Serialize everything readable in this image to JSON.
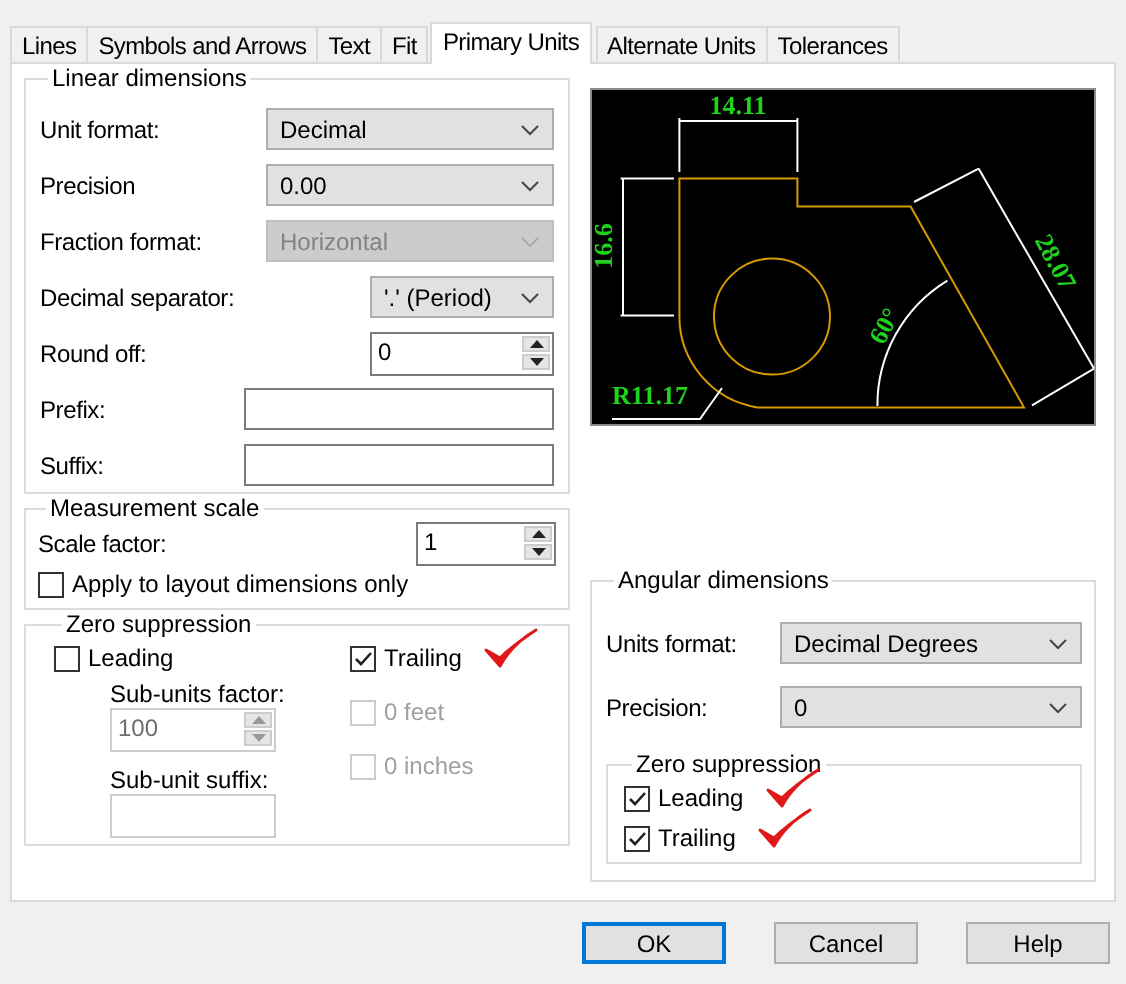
{
  "tabs": [
    {
      "label": "Lines",
      "selected": false
    },
    {
      "label": "Symbols and Arrows",
      "selected": false
    },
    {
      "label": "Text",
      "selected": false
    },
    {
      "label": "Fit",
      "selected": false
    },
    {
      "label": "Primary Units",
      "selected": true
    },
    {
      "label": "Alternate Units",
      "selected": false
    },
    {
      "label": "Tolerances",
      "selected": false
    }
  ],
  "linear_dimensions": {
    "title": "Linear dimensions",
    "fields": [
      {
        "kind": "select",
        "label": "Unit format:",
        "value": "Decimal",
        "disabled": false
      },
      {
        "kind": "select",
        "label": "Precision",
        "value": "0.00",
        "disabled": false
      },
      {
        "kind": "select",
        "label": "Fraction format:",
        "value": "Horizontal",
        "disabled": true
      },
      {
        "kind": "select_short",
        "label": "Decimal separator:",
        "value": "'.' (Period)",
        "disabled": false
      },
      {
        "kind": "spinner",
        "label": "Round off:",
        "value": "0",
        "disabled": false
      },
      {
        "kind": "text",
        "label": "Prefix:"
      },
      {
        "kind": "text",
        "label": "Suffix:"
      }
    ]
  },
  "measurement_scale": {
    "title": "Measurement scale",
    "scale_factor": {
      "label": "Scale factor:",
      "value": "1"
    },
    "apply_layout": {
      "label": "Apply to layout dimensions only",
      "checked": false,
      "disabled": false,
      "annotated": false
    }
  },
  "zero_suppression": {
    "title": "Zero suppression",
    "leading": {
      "label": "Leading",
      "checked": false,
      "disabled": false,
      "annotated": false
    },
    "trailing": {
      "label": "Trailing",
      "checked": true,
      "disabled": false,
      "annotated": true
    },
    "sub_units_factor": {
      "label": "Sub-units factor:",
      "value": "100",
      "disabled": true
    },
    "sub_unit_suffix": {
      "label": "Sub-unit suffix:"
    },
    "feet": {
      "label": "0 feet",
      "checked": false,
      "disabled": true,
      "annotated": false
    },
    "inches": {
      "label": "0 inches",
      "checked": false,
      "disabled": true,
      "annotated": false
    }
  },
  "preview": {
    "labels": [
      {
        "kind": "top",
        "text": "14.11"
      },
      {
        "kind": "left",
        "text": "16.6"
      },
      {
        "kind": "slant",
        "text": "28.07"
      },
      {
        "kind": "angle",
        "text": "60°"
      },
      {
        "kind": "radius",
        "text": "R11.17"
      }
    ]
  },
  "angular_dimensions": {
    "title": "Angular dimensions",
    "units_format": {
      "label": "Units format:",
      "value": "Decimal Degrees"
    },
    "precision": {
      "label": "Precision:",
      "value": "0"
    },
    "zero_suppression": {
      "title": "Zero suppression",
      "options": [
        {
          "label": "Leading",
          "checked": true,
          "disabled": false,
          "annotated": true
        },
        {
          "label": "Trailing",
          "checked": true,
          "disabled": false,
          "annotated": true
        }
      ]
    }
  },
  "buttons": [
    {
      "label": "OK",
      "default": true
    },
    {
      "label": "Cancel",
      "default": false
    },
    {
      "label": "Help",
      "default": false
    }
  ]
}
